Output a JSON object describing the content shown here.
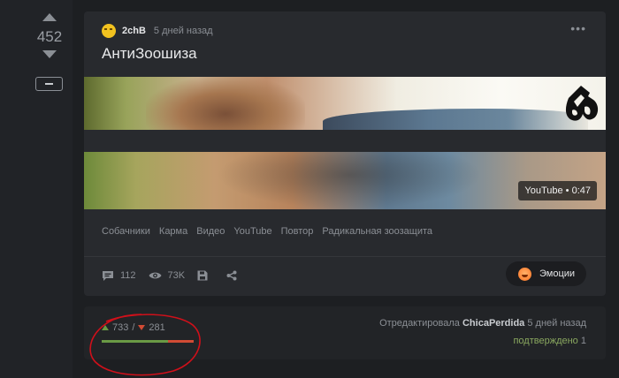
{
  "rating": {
    "score": "452"
  },
  "post": {
    "author": "2chB",
    "time": "5 дней назад",
    "title": "АнтиЗоошиза",
    "video": {
      "badge": "YouTube • 0:47"
    },
    "tags": [
      "Собачники",
      "Карма",
      "Видео",
      "YouTube",
      "Повтор",
      "Радикальная зоозащита"
    ],
    "stats": {
      "comments": "112",
      "views": "73K"
    },
    "emotion_label": "Эмоции"
  },
  "footer": {
    "upvotes": "733",
    "downvotes": "281",
    "upvote_fraction": 0.723,
    "edited_prefix": "Отредактировала",
    "editor": "ChicaPerdida",
    "edited_time": "5 дней назад",
    "confirmed_label": "подтверждено",
    "confirmed_count": "1"
  },
  "colors": {
    "background": "#1d1f22",
    "card": "#282a2e",
    "positive": "#6a9a45",
    "negative": "#d14b34",
    "annotation": "#d0101a"
  },
  "icons": [
    "chevron-up-icon",
    "chevron-down-icon",
    "minus-icon",
    "more-icon",
    "comment-icon",
    "eye-icon",
    "save-icon",
    "share-icon",
    "emoji-icon"
  ]
}
